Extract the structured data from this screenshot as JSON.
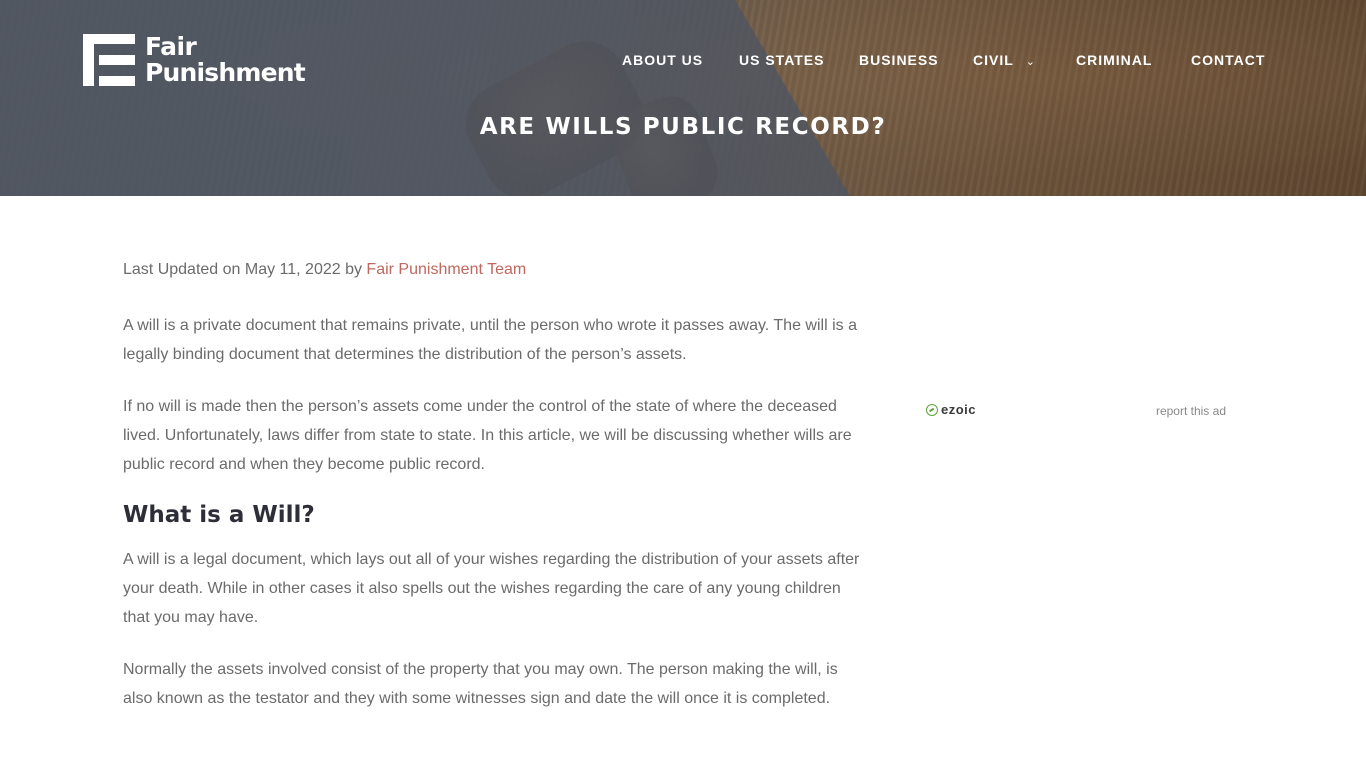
{
  "header": {
    "logo": {
      "line1": "Fair",
      "line2": "Punishment"
    },
    "nav": [
      {
        "label": "ABOUT US"
      },
      {
        "label": "US STATES"
      },
      {
        "label": "BUSINESS"
      },
      {
        "label": "CIVIL",
        "has_dropdown": true,
        "icon": "chevron-down-icon"
      },
      {
        "label": "CRIMINAL"
      },
      {
        "label": "CONTACT"
      }
    ],
    "page_title": "ARE WILLS PUBLIC RECORD?"
  },
  "article": {
    "meta_prefix": "Last Updated on May 11, 2022 by ",
    "author": "Fair Punishment Team",
    "paragraphs": [
      "A will is a private document that remains private, until the person who wrote it passes away. The will is a legally binding document that determines the distribution of the person’s assets.",
      "If no will is made then the person’s assets come under the control of the state of where the deceased lived. Unfortunately, laws differ from state to state. In this article, we will be discussing whether wills are public record and when they become public record."
    ],
    "heading": "What is a Will?",
    "paragraphs2": [
      "A will is a legal document, which lays out all of your wishes regarding the distribution of your assets after your death. While in other cases it also spells out the wishes regarding the care of any young children that you may have.",
      "Normally the assets involved consist of the property that you may own. The person making the will, is also known as the testator and they with some witnesses sign and date the will once it is completed."
    ]
  },
  "ad": {
    "brand": "ezoic",
    "report_label": "report this ad"
  },
  "colors": {
    "link": "#c0685f",
    "body_text": "#6b6b6b",
    "heading": "#2e2e38",
    "ezoic_green": "#5ea33b"
  }
}
